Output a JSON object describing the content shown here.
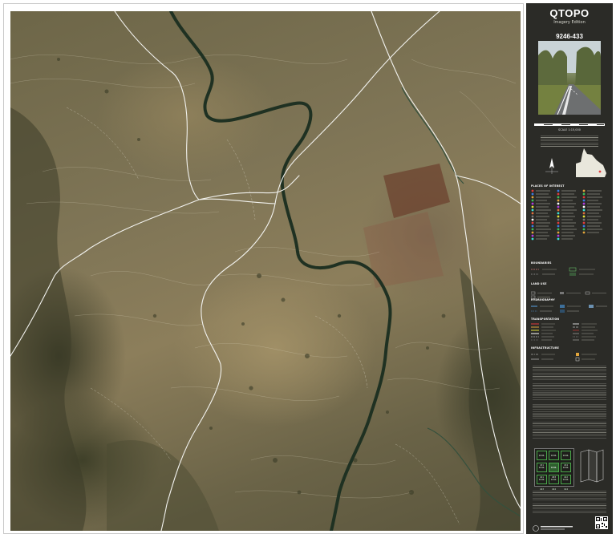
{
  "panel": {
    "title": "QTOPO",
    "subtitle": "Imagery Edition",
    "sheet_number": "9246-433",
    "scale_label": "SCALE 1:15,000"
  },
  "legend": {
    "sections": [
      {
        "id": "places",
        "heading": "PLACES OF INTEREST"
      },
      {
        "id": "boundaries",
        "heading": "BOUNDARIES"
      },
      {
        "id": "land_use",
        "heading": "LAND USE"
      },
      {
        "id": "hydrography",
        "heading": "HYDROGRAPHY"
      },
      {
        "id": "transportation",
        "heading": "TRANSPORTATION"
      },
      {
        "id": "infrastructure",
        "heading": "INFRASTRUCTURE"
      }
    ],
    "poi_colors": [
      "#e23b3b",
      "#3b7be2",
      "#e2a53b",
      "#3bbf5a",
      "#b03be2",
      "#e2e23b",
      "#3be2d6",
      "#e26f3b",
      "#7a7a7a",
      "#ffffff"
    ]
  },
  "index": {
    "cells": [
      "9246-431",
      "9246-432",
      "9246-434",
      "9246-433",
      "9246-441",
      "9246-442",
      "9246-443",
      "9246-444",
      "9246-414"
    ]
  },
  "map": {
    "colors": {
      "river": "#1f3122",
      "road": "#f2f2ee",
      "contour": "#d9d4c0",
      "panel_bg": "#2b2b27"
    }
  }
}
